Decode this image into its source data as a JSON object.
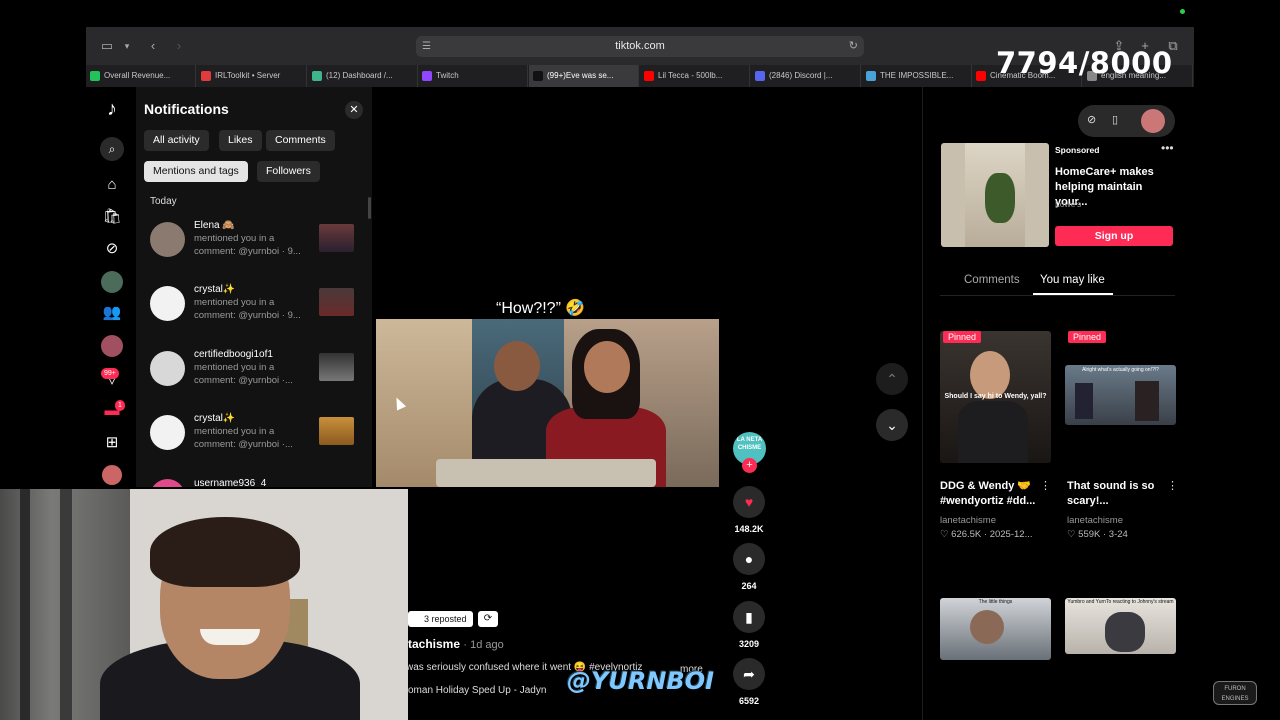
{
  "overlay": {
    "counter": "7794/8000"
  },
  "browser": {
    "url": "tiktok.com",
    "tabs": [
      {
        "label": "Overall Revenue...",
        "color": "#21c35a"
      },
      {
        "label": "IRLToolkit • Server",
        "color": "#e23b3b"
      },
      {
        "label": "(12) Dashboard /...",
        "color": "#3fb58c"
      },
      {
        "label": "Twitch",
        "color": "#9146ff"
      },
      {
        "label": "(99+)Eve was se...",
        "color": "#111111"
      },
      {
        "label": "Lil Tecca - 500lb...",
        "color": "#ff0000"
      },
      {
        "label": "(2846) Discord |...",
        "color": "#5865f2"
      },
      {
        "label": "THE IMPOSSIBLE...",
        "color": "#4aa3d8"
      },
      {
        "label": "Cinematic Boom...",
        "color": "#ff0000"
      },
      {
        "label": "english meaning...",
        "color": "#888888"
      }
    ]
  },
  "rail": {
    "badge_inbox": "99+",
    "badge_msg": "1"
  },
  "notifications": {
    "title": "Notifications",
    "chips": [
      "All activity",
      "Likes",
      "Comments",
      "Mentions and tags",
      "Followers"
    ],
    "section": "Today",
    "items": [
      {
        "name": "Elena 🙈",
        "line1": "mentioned you in a",
        "line2": "comment: @yurnboi · 9..."
      },
      {
        "name": "crystal✨",
        "line1": "mentioned you in a",
        "line2": "comment: @yurnboi · 9..."
      },
      {
        "name": "certifiedboogi1of1",
        "line1": "mentioned you in a",
        "line2": "comment: @yurnboi ·..."
      },
      {
        "name": "crystal✨",
        "line1": "mentioned you in a",
        "line2": "comment: @yurnboi ·..."
      },
      {
        "name": "username936_4",
        "line1": "",
        "line2": ""
      }
    ]
  },
  "video": {
    "overlay_text": "“How?!?” 🤣",
    "stats": {
      "likes": "148.2K",
      "comments": "264",
      "saves": "3209",
      "shares": "6592"
    },
    "reposted": "3 reposted",
    "author": "tachisme",
    "ago": "· 1d ago",
    "caption": "was seriously confused where it went 😝 #evelynortiz",
    "more": "more",
    "music": "oman Holiday Sped Up - Jadyn",
    "watermark": "@YURNBOI",
    "creator_avatar_text": "LA NETA CHISME"
  },
  "ad": {
    "sponsored": "Sponsored",
    "title": "HomeCare+ makes helping maintain your...",
    "brand": "Lowe's",
    "cta": "Sign up"
  },
  "right_tabs": {
    "comments": "Comments",
    "you_may_like": "You may like"
  },
  "recommendations": [
    {
      "pinned": "Pinned",
      "caption": "Should I say hi to Wendy, yall?",
      "title": "DDG & Wendy 🤝 #wendyortiz #dd...",
      "author": "lanetachisme",
      "stats": "♡ 626.5K · 2025-12..."
    },
    {
      "pinned": "Pinned",
      "caption": "Alright what's actually going on!?!?",
      "title": "That sound is so scary!...",
      "author": "lanetachisme",
      "stats": "♡ 559K · 3-24"
    },
    {
      "caption": "The little things"
    },
    {
      "caption": "Yumbro and YurnTo reacting to Johnny's stream"
    }
  ],
  "corner_logo": "FURON ENGINES"
}
